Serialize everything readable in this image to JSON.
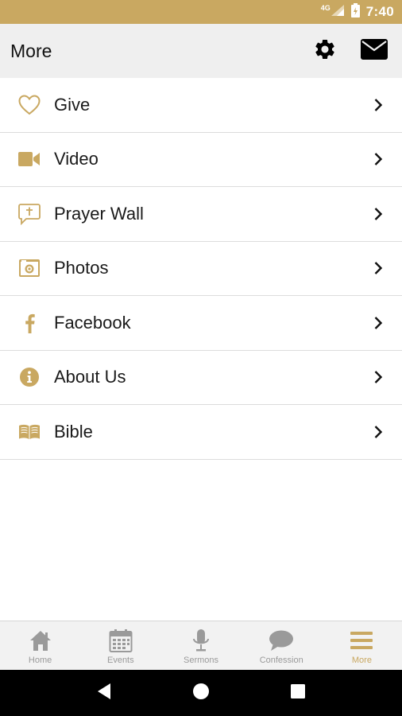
{
  "status_bar": {
    "network": "4G",
    "time": "7:40"
  },
  "app_bar": {
    "title": "More"
  },
  "menu": {
    "items": [
      {
        "label": "Give",
        "icon": "heart-icon"
      },
      {
        "label": "Video",
        "icon": "video-camera-icon"
      },
      {
        "label": "Prayer Wall",
        "icon": "prayer-bubble-icon"
      },
      {
        "label": "Photos",
        "icon": "camera-icon"
      },
      {
        "label": "Facebook",
        "icon": "facebook-icon"
      },
      {
        "label": "About Us",
        "icon": "info-icon"
      },
      {
        "label": "Bible",
        "icon": "book-icon"
      }
    ]
  },
  "bottom_nav": {
    "items": [
      {
        "label": "Home",
        "icon": "home-icon"
      },
      {
        "label": "Events",
        "icon": "calendar-icon"
      },
      {
        "label": "Sermons",
        "icon": "microphone-icon"
      },
      {
        "label": "Confession",
        "icon": "chat-bubble-icon"
      },
      {
        "label": "More",
        "icon": "menu-icon",
        "active": true
      }
    ]
  },
  "colors": {
    "accent": "#c9a861",
    "inactive": "#9a9a9a",
    "app_bar_bg": "#efefef"
  }
}
